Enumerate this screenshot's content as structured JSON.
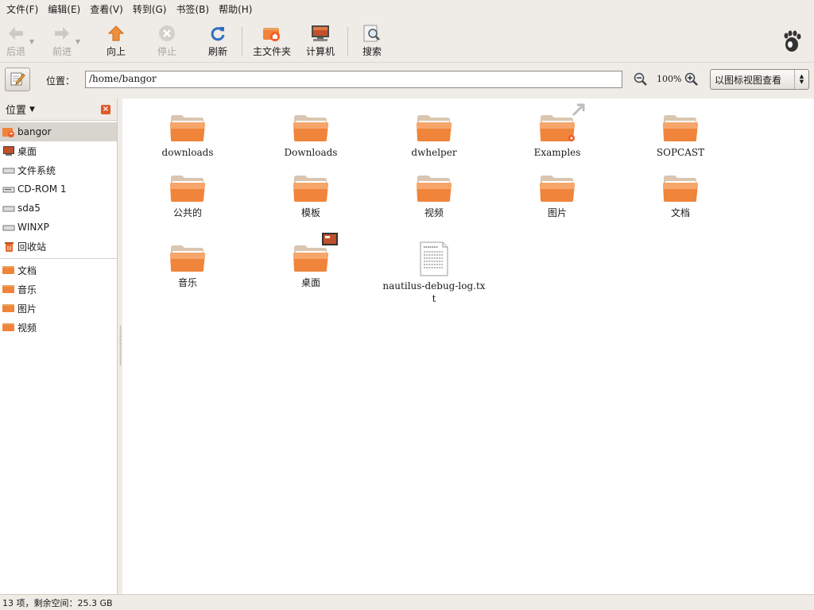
{
  "menubar": {
    "items": [
      "文件(F)",
      "编辑(E)",
      "查看(V)",
      "转到(G)",
      "书签(B)",
      "帮助(H)"
    ]
  },
  "toolbar": {
    "back": {
      "label": "后退",
      "icon": "back-arrow-icon",
      "enabled": false
    },
    "forward": {
      "label": "前进",
      "icon": "forward-arrow-icon",
      "enabled": false
    },
    "up": {
      "label": "向上",
      "icon": "up-arrow-icon",
      "enabled": true
    },
    "stop": {
      "label": "停止",
      "icon": "stop-icon",
      "enabled": false
    },
    "reload": {
      "label": "刷新",
      "icon": "reload-icon",
      "enabled": true
    },
    "home": {
      "label": "主文件夹",
      "icon": "home-folder-icon",
      "enabled": true
    },
    "computer": {
      "label": "计算机",
      "icon": "computer-icon",
      "enabled": true
    },
    "search": {
      "label": "搜索",
      "icon": "search-icon",
      "enabled": true
    }
  },
  "location": {
    "label": "位置：",
    "path": "/home/bangor",
    "zoom": "100%",
    "view_mode": "以图标视图查看"
  },
  "sidebar": {
    "title": "位置",
    "items": [
      {
        "label": "bangor",
        "icon": "home-icon",
        "selected": true
      },
      {
        "label": "桌面",
        "icon": "desktop-icon",
        "selected": false
      },
      {
        "label": "文件系统",
        "icon": "drive-icon",
        "selected": false
      },
      {
        "label": "CD-ROM 1",
        "icon": "cdrom-icon",
        "selected": false
      },
      {
        "label": "sda5",
        "icon": "drive-icon",
        "selected": false
      },
      {
        "label": "WINXP",
        "icon": "drive-icon",
        "selected": false
      },
      {
        "label": "回收站",
        "icon": "trash-icon",
        "selected": false
      }
    ],
    "bookmarks": [
      {
        "label": "文档",
        "icon": "folder-icon"
      },
      {
        "label": "音乐",
        "icon": "folder-icon"
      },
      {
        "label": "图片",
        "icon": "folder-icon"
      },
      {
        "label": "视频",
        "icon": "folder-icon"
      }
    ]
  },
  "files": [
    {
      "name": "downloads",
      "type": "folder"
    },
    {
      "name": "Downloads",
      "type": "folder"
    },
    {
      "name": "dwhelper",
      "type": "folder"
    },
    {
      "name": "Examples",
      "type": "folder-link"
    },
    {
      "name": "SOPCAST",
      "type": "folder"
    },
    {
      "name": "公共的",
      "type": "folder"
    },
    {
      "name": "模板",
      "type": "folder"
    },
    {
      "name": "视频",
      "type": "folder"
    },
    {
      "name": "图片",
      "type": "folder"
    },
    {
      "name": "文档",
      "type": "folder"
    },
    {
      "name": "音乐",
      "type": "folder"
    },
    {
      "name": "桌面",
      "type": "folder-desktop"
    },
    {
      "name": "nautilus-debug-log.txt",
      "type": "text-file"
    }
  ],
  "status": {
    "text": "13 项，剩余空间：25.3 GB"
  },
  "colors": {
    "folder_orange": "#f0843a",
    "window_bg": "#efebe6",
    "accent_red": "#e05a2b"
  }
}
